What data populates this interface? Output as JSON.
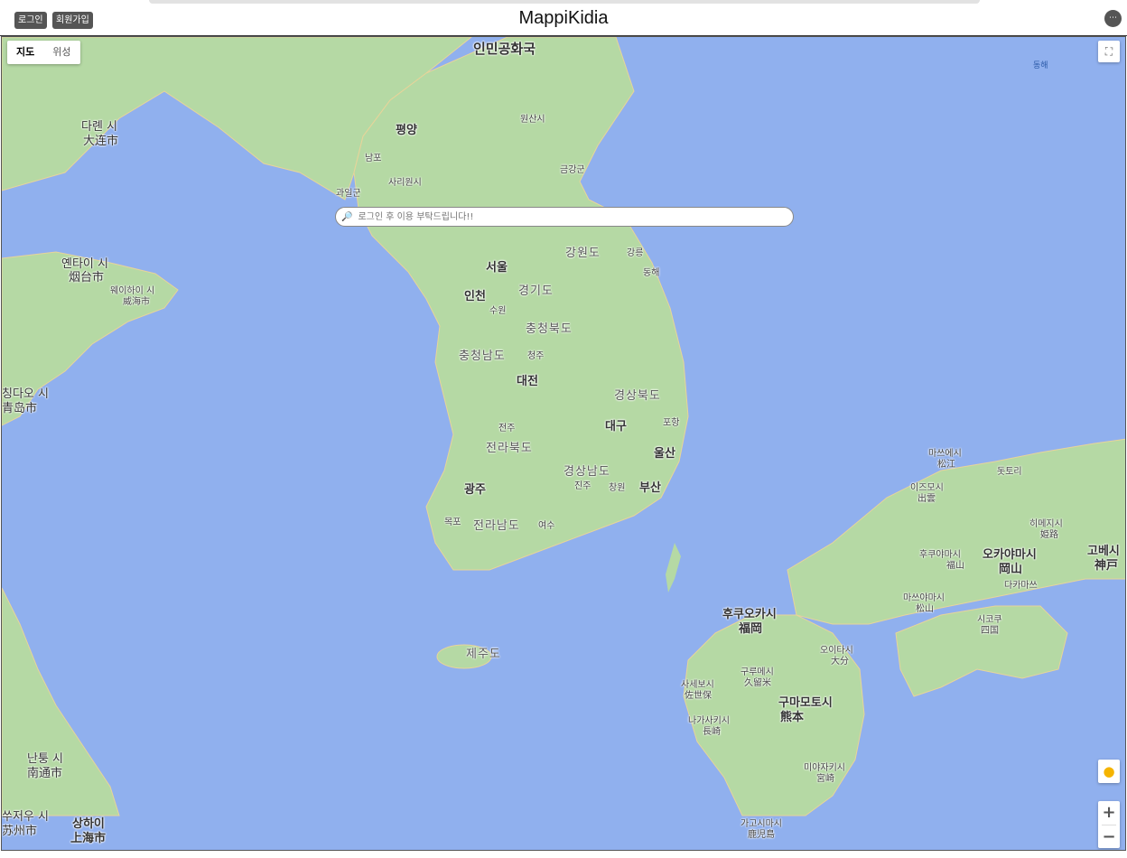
{
  "header": {
    "login_label": "로그인",
    "signup_label": "회원가입",
    "title": "MappiKidia",
    "menu_icon": "menu-icon",
    "menu_label": "⋯"
  },
  "map": {
    "map_type_options": [
      "지도",
      "위성"
    ],
    "map_type_selected": "지도",
    "search_placeholder": "로그인 후 이용 부탁드립니다!!",
    "water_color": "#90b0ee",
    "land_color": "#b5d9a4",
    "labels": {
      "north_korea": "인민공화국",
      "dalian_kr": "다롄 시",
      "dalian_cn": "大连市",
      "pyongyang": "평양",
      "wonsan": "원산시",
      "nampo": "남포",
      "sariwon": "사리원시",
      "gwail": "과일군",
      "geumgang": "금강군",
      "yantai_kr": "옌타이 시",
      "yantai_cn": "烟台市",
      "weihai_kr": "웨이하이 시",
      "weihai_cn": "威海市",
      "seoul": "서울",
      "incheon": "인천",
      "suwon": "수원",
      "gyeonggi": "경기도",
      "gangwon": "강원도",
      "gangneung": "강릉",
      "donghae": "동해",
      "chungbuk": "충청북도",
      "chungnam": "충청남도",
      "cheongju": "청주",
      "daejeon": "대전",
      "gyeongbuk": "경상북도",
      "daegu": "대구",
      "pohang": "포항",
      "jeonju": "전주",
      "jeonbuk": "전라북도",
      "ulsan": "울산",
      "gyeongnam": "경상남도",
      "gwangju": "광주",
      "jinju": "진주",
      "changwon": "창원",
      "busan": "부산",
      "mokpo": "목포",
      "jeonnam": "전라남도",
      "yeosu": "여수",
      "jeju": "제주도",
      "east_sea": "동해",
      "matsue_kr": "마쓰에시",
      "matsue_jp": "松江",
      "tottori": "돗토리",
      "izumo_kr": "이즈모시",
      "izumo_jp": "出雲",
      "okayama_kr": "오카야마시",
      "okayama_jp": "岡山",
      "fukuyama_kr": "후쿠야마시",
      "fukuyama_jp": "福山",
      "himeji_kr": "히메지시",
      "himeji_jp": "姫路",
      "kobe_kr": "고베시",
      "kobe_jp": "神戸",
      "matsuyama_kr": "마쓰야마시",
      "matsuyama_jp": "松山",
      "takamatsu": "다카마쓰",
      "shikoku_kr": "시코쿠",
      "shikoku_jp": "四国",
      "fukuoka_kr": "후쿠오카시",
      "fukuoka_jp": "福岡",
      "oita_kr": "오이타시",
      "oita_jp": "大分",
      "kurume_kr": "구루메시",
      "kurume_jp": "久留米",
      "sasebo_kr": "사세보시",
      "sasebo_jp": "佐世保",
      "kumamoto_kr": "구마모토시",
      "kumamoto_jp": "熊本",
      "nagasaki_kr": "나가사키시",
      "nagasaki_jp": "長崎",
      "miyazaki_kr": "미야자키시",
      "miyazaki_jp": "宮崎",
      "kagoshima_kr": "가고시마시",
      "kagoshima_jp": "鹿児島",
      "nantong_kr": "난퉁 시",
      "nantong_cn": "南通市",
      "suzhou_kr": "쑤저우 시",
      "suzhou_cn": "苏州市",
      "shanghai_kr": "상하이",
      "shanghai_cn": "上海市",
      "qingdao_kr": "칭다오 시",
      "qingdao_cn": "青岛市"
    }
  }
}
